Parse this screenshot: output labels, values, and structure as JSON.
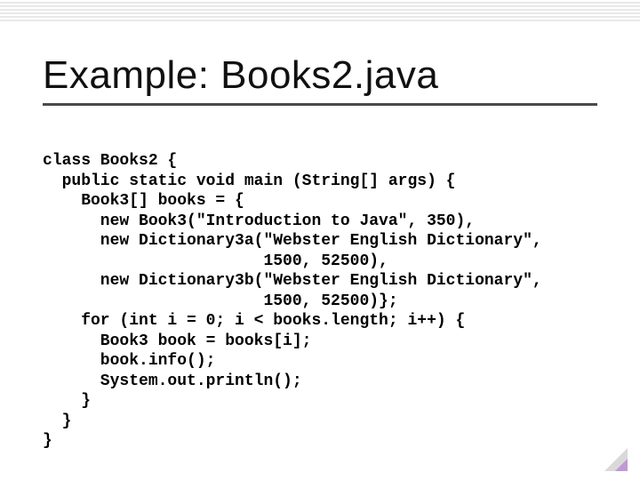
{
  "title": "Example: Books2.java",
  "code": {
    "l01": "class Books2 {",
    "l02": "  public static void main (String[] args) {",
    "l03": "    Book3[] books = {",
    "l04": "      new Book3(\"Introduction to Java\", 350),",
    "l05": "      new Dictionary3a(\"Webster English Dictionary\",",
    "l06": "                       1500, 52500),",
    "l07": "      new Dictionary3b(\"Webster English Dictionary\",",
    "l08": "                       1500, 52500)};",
    "l09": "    for (int i = 0; i < books.length; i++) {",
    "l10": "      Book3 book = books[i];",
    "l11": "      book.info();",
    "l12": "      System.out.println();",
    "l13": "    }",
    "l14": "  }",
    "l15": "}"
  }
}
